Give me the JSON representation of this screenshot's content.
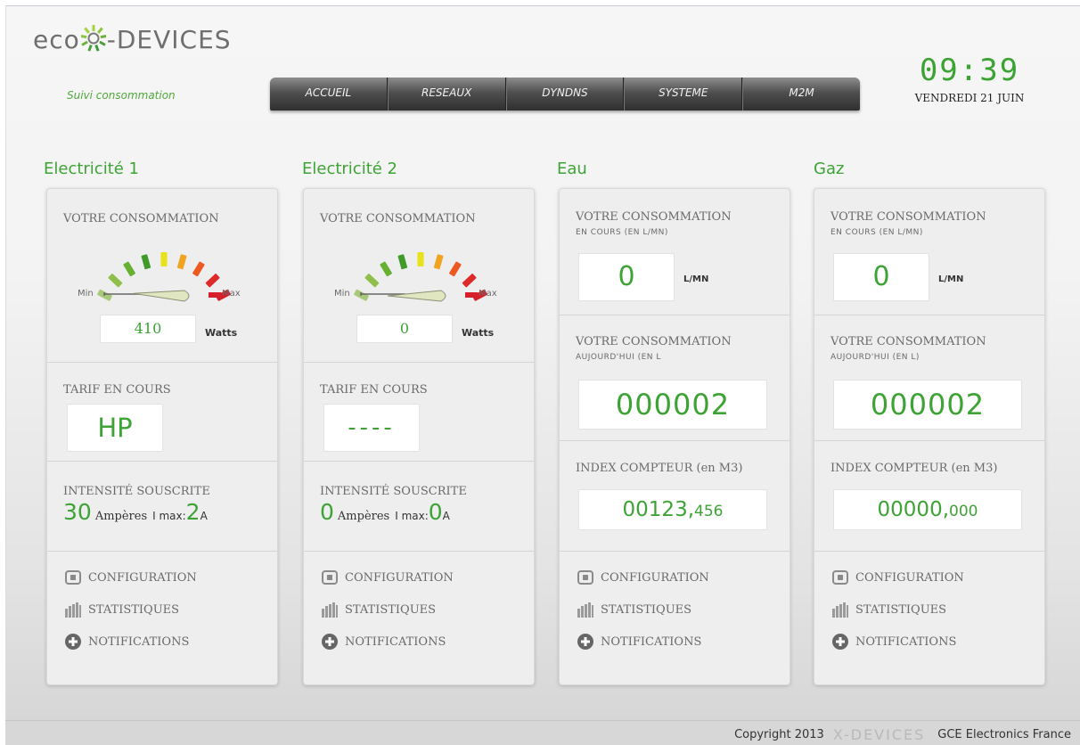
{
  "header": {
    "logo_prefix": "eco",
    "logo_suffix": "-DEVICES",
    "tagline": "Suivi consommation",
    "clock_time": "09:39",
    "clock_date": "VENDREDI 21 JUIN"
  },
  "nav": {
    "items": [
      {
        "label": "ACCUEIL"
      },
      {
        "label": "RESEAUX"
      },
      {
        "label": "DYNDNS"
      },
      {
        "label": "SYSTEME"
      },
      {
        "label": "M2M"
      }
    ]
  },
  "panels": {
    "elec1": {
      "title": "Electricité 1",
      "consumption_label": "VOTRE CONSOMMATION",
      "gauge_min": "Min",
      "gauge_max": "Max",
      "gauge_value": 0.1,
      "watts_value": "410",
      "watts_unit": "Watts",
      "tarif_label": "TARIF EN COURS",
      "tarif_value": "HP",
      "intensity_label": "INTENSITÉ SOUSCRITE",
      "intensity_value": "30",
      "intensity_unit": "Ampères",
      "imax_label": "I max:",
      "imax_value": "2",
      "imax_unit": "A"
    },
    "elec2": {
      "title": "Electricité 2",
      "consumption_label": "VOTRE CONSOMMATION",
      "gauge_min": "Min",
      "gauge_max": "Max",
      "gauge_value": 0.0,
      "watts_value": "0",
      "watts_unit": "Watts",
      "tarif_label": "TARIF EN COURS",
      "tarif_value": "----",
      "intensity_label": "INTENSITÉ SOUSCRITE",
      "intensity_value": "0",
      "intensity_unit": "Ampères",
      "imax_label": "I max:",
      "imax_value": "0",
      "imax_unit": "A"
    },
    "eau": {
      "title": "Eau",
      "consumption_label": "VOTRE CONSOMMATION",
      "current_sub": "EN COURS (EN L/MN)",
      "current_value": "0",
      "current_unit": "L/MN",
      "today_label": "VOTRE CONSOMMATION",
      "today_sub": "AUJOURD'HUI (EN L",
      "today_value": "000002",
      "index_label": "INDEX COMPTEUR (en M3)",
      "index_int": "00123,",
      "index_dec": "456"
    },
    "gaz": {
      "title": "Gaz",
      "consumption_label": "VOTRE CONSOMMATION",
      "current_sub": "EN COURS (EN L/MN)",
      "current_value": "0",
      "current_unit": "L/MN",
      "today_label": "VOTRE CONSOMMATION",
      "today_sub": "AUJOURD'HUI (EN L)",
      "today_value": "000002",
      "index_label": "INDEX COMPTEUR (en M3)",
      "index_int": "00000,",
      "index_dec": "000"
    }
  },
  "menu": {
    "configuration": "CONFIGURATION",
    "statistiques": "STATISTIQUES",
    "notifications": "NOTIFICATIONS"
  },
  "footer": {
    "copyright": "Copyright 2013",
    "brand": "X-DEVICES",
    "company": "GCE Electronics France"
  },
  "colors": {
    "accent_green": "#3da335",
    "nav_dark": "#3a3a3a"
  }
}
